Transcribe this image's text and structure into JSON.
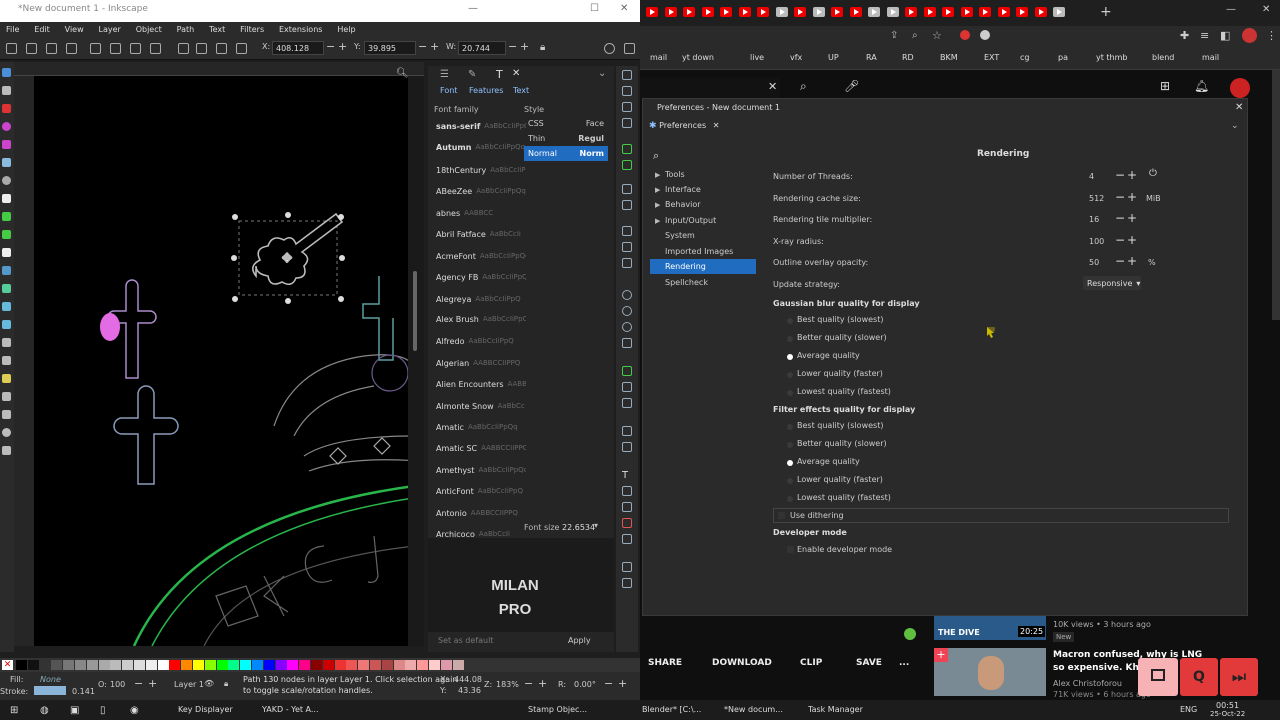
{
  "inkscape": {
    "title": "*New document 1 - Inkscape",
    "menu": [
      "File",
      "Edit",
      "View",
      "Layer",
      "Object",
      "Path",
      "Text",
      "Filters",
      "Extensions",
      "Help"
    ],
    "x_label": "X:",
    "x_value": "408.128",
    "y_label": "Y:",
    "y_value": "39.895",
    "w_label": "W:",
    "w_value": "20.744",
    "font_tabs": [
      "Font",
      "Features",
      "Text"
    ],
    "font_family_label": "Font family",
    "style_label": "Style",
    "fonts": [
      "sans-serif",
      "Autumn",
      "18thCentury",
      "ABeeZee",
      "abnes",
      "Abril Fatface",
      "AcmeFont",
      "Agency FB",
      "Alegreya",
      "Alex Brush",
      "Alfredo",
      "Algerian",
      "Alien Encounters",
      "Almonte Snow",
      "Amatic",
      "Amatic SC",
      "Amethyst",
      "AnticFont",
      "Antonio",
      "Archicoco"
    ],
    "font_previews": [
      "AaBbCcIiPpQq",
      "AaBbCcIiPpQq",
      "AaBbCcIiPpQq",
      "AaBbCcIiPpQq",
      "AABBCC",
      "AaBbCcIi",
      "AaBbCcIiPpQq",
      "AaBbCcIiPpQ",
      "AaBbCcIiPpQ",
      "AaBbCcIiPpQ",
      "AaBbCcIiPpQ",
      "AABBCCIIPPQ",
      "AABB",
      "AaBbCc",
      "AaBbCcIiPpQq",
      "AABBCCIIPPQ",
      "AaBbCcIiPpQq",
      "AaBbCcIiPpQ",
      "AABBCCIIPPQ",
      "AaBbCcIi"
    ],
    "style_cols": [
      "CSS",
      "Face"
    ],
    "styles": [
      [
        "Thin",
        "Regul"
      ],
      [
        "Normal",
        "Norm"
      ]
    ],
    "font_size_label": "Font size",
    "font_size_value": "22.6534",
    "preview_text": [
      "MILAN",
      "PRO"
    ],
    "set_default": "Set as default",
    "apply": "Apply",
    "status_fill": "Fill:",
    "status_fill_value": "None",
    "status_stroke": "Stroke:",
    "status_stroke_value": "0.141",
    "opacity_label": "O:",
    "opacity_value": "100",
    "layer": "Layer 1",
    "status_msg_1": "Path 130 nodes in layer Layer 1. Click selection again",
    "status_msg_2": "to toggle scale/rotation handles.",
    "status_x_label": "X:",
    "status_x": "444.08",
    "status_y_label": "Y:",
    "status_y": "43.36",
    "zoom_label": "Z:",
    "zoom": "183%",
    "rot_label": "R:",
    "rot": "0.00°"
  },
  "browser": {
    "bookmarks": [
      "mail",
      "yt down",
      "live",
      "vfx",
      "UP",
      "RA",
      "RD",
      "BKM",
      "EXT",
      "cg",
      "pa",
      "yt thmb",
      "blend",
      "mail"
    ]
  },
  "prefs": {
    "title": "Preferences - New document 1",
    "tab": "Preferences",
    "heading": "Rendering",
    "nav": [
      "Tools",
      "Interface",
      "Behavior",
      "Input/Output",
      "System",
      "Imported Images",
      "Rendering",
      "Spellcheck"
    ],
    "rows": [
      {
        "label": "Number of Threads:",
        "value": "4",
        "unit": ""
      },
      {
        "label": "Rendering cache size:",
        "value": "512",
        "unit": "MiB"
      },
      {
        "label": "Rendering tile multiplier:",
        "value": "16",
        "unit": ""
      },
      {
        "label": "X-ray radius:",
        "value": "100",
        "unit": ""
      },
      {
        "label": "Outline overlay opacity:",
        "value": "50",
        "unit": "%"
      }
    ],
    "update_label": "Update strategy:",
    "update_value": "Responsive",
    "blur_heading": "Gaussian blur quality for display",
    "filter_heading": "Filter effects quality for display",
    "qualities": [
      "Best quality (slowest)",
      "Better quality (slower)",
      "Average quality",
      "Lower quality (faster)",
      "Lowest quality (fastest)"
    ],
    "dithering": "Use dithering",
    "dev_heading": "Developer mode",
    "dev_option": "Enable developer mode"
  },
  "youtube": {
    "actions": [
      "SHARE",
      "DOWNLOAD",
      "CLIP",
      "SAVE",
      "..."
    ],
    "card1_meta": "10K views • 3 hours ago",
    "card1_badge": "New",
    "card1_duration": "20:25",
    "card1_thumb": "THE DIVE",
    "card2_title_1": "Macron confused, why is LNG",
    "card2_title_2": "so expensive. Kherso",
    "card2_channel": "Alex Christoforou",
    "card2_meta": "71K views • 6 hours ago"
  },
  "taskbar": {
    "items": [
      "Key Displayer",
      "YAKD - Yet A...",
      "Stamp Objec...",
      "Blender* [C:\\...",
      "*New docum...",
      "Task Manager"
    ],
    "lang": "ENG",
    "time": "00:51",
    "date": "25-Oct-22"
  },
  "colors": {
    "accent": "#1f6cc1",
    "youtube_red": "#e00000",
    "canvas": "#000000"
  }
}
